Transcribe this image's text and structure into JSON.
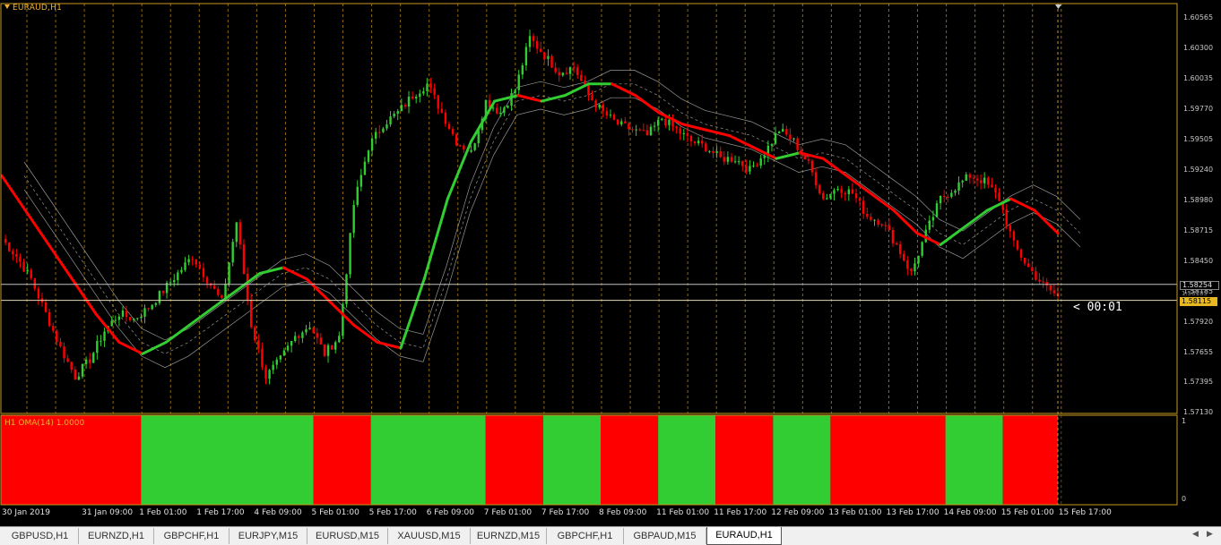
{
  "window": {
    "symbol_label": "EURAUD,H1",
    "indicator_label": "H1 OMA(14) 1.0000",
    "countdown": "< 00:01"
  },
  "colors": {
    "bull": "#32cd32",
    "bear": "#ff0000",
    "grid": "#c8961e",
    "frame": "#c8961e",
    "current_price_bg": "#e8b820"
  },
  "price_axis": {
    "ticks": [
      "1.60565",
      "1.60300",
      "1.60035",
      "1.59770",
      "1.59505",
      "1.59240",
      "1.58980",
      "1.58715",
      "1.58450",
      "1.58185",
      "1.57920",
      "1.57655",
      "1.57395",
      "1.57130"
    ],
    "hline_price": "1.58254",
    "current_price": "1.58115",
    "behind_price": "1.58185"
  },
  "indicator_axis": {
    "max": "1",
    "min": "0"
  },
  "time_axis": {
    "labels": [
      "30 Jan 2019",
      "31 Jan 09:00",
      "1 Feb 01:00",
      "1 Feb 17:00",
      "4 Feb 09:00",
      "5 Feb 01:00",
      "5 Feb 17:00",
      "6 Feb 09:00",
      "7 Feb 01:00",
      "7 Feb 17:00",
      "8 Feb 09:00",
      "11 Feb 01:00",
      "11 Feb 17:00",
      "12 Feb 09:00",
      "13 Feb 01:00",
      "13 Feb 17:00",
      "14 Feb 09:00",
      "15 Feb 01:00",
      "15 Feb 17:00"
    ]
  },
  "tabs": [
    {
      "label": "GBPUSD,H1",
      "active": false
    },
    {
      "label": "EURNZD,H1",
      "active": false
    },
    {
      "label": "GBPCHF,H1",
      "active": false
    },
    {
      "label": "EURJPY,M15",
      "active": false
    },
    {
      "label": "EURUSD,M15",
      "active": false
    },
    {
      "label": "XAUUSD,M15",
      "active": false
    },
    {
      "label": "EURNZD,M15",
      "active": false
    },
    {
      "label": "GBPCHF,H1",
      "active": false
    },
    {
      "label": "GBPAUD,M15",
      "active": false
    },
    {
      "label": "EURAUD,H1",
      "active": true
    }
  ],
  "nav": {
    "left_icon": "triangle-left-icon",
    "right_icon": "triangle-right-icon"
  },
  "chart_data": {
    "type": "candlestick",
    "symbol": "EURAUD",
    "timeframe": "H1",
    "ylim": [
      1.5713,
      1.607
    ],
    "candles_close_trace": [
      1.5865,
      1.585,
      1.583,
      1.58,
      1.577,
      1.5745,
      1.576,
      1.5785,
      1.58,
      1.5795,
      1.5805,
      1.582,
      1.5835,
      1.585,
      1.583,
      1.581,
      1.588,
      1.579,
      1.5745,
      1.576,
      1.578,
      1.579,
      1.5765,
      1.578,
      1.5895,
      1.5945,
      1.5965,
      1.5975,
      1.599,
      1.6,
      1.5975,
      1.595,
      1.594,
      1.5985,
      1.5975,
      1.5995,
      1.604,
      1.6025,
      1.601,
      1.6015,
      1.599,
      1.5975,
      1.5965,
      1.596,
      1.5955,
      1.597,
      1.596,
      1.595,
      1.5945,
      1.5935,
      1.5935,
      1.5925,
      1.594,
      1.596,
      1.595,
      1.593,
      1.59,
      1.591,
      1.5905,
      1.5885,
      1.588,
      1.586,
      1.5835,
      1.587,
      1.59,
      1.591,
      1.592,
      1.5915,
      1.59,
      1.586,
      1.584,
      1.5825,
      1.5815
    ],
    "oma_trace": [
      1.592,
      1.589,
      1.586,
      1.583,
      1.58,
      1.5775,
      1.5765,
      1.5775,
      1.579,
      1.5805,
      1.582,
      1.5835,
      1.584,
      1.583,
      1.581,
      1.579,
      1.5775,
      1.577,
      1.583,
      1.59,
      1.595,
      1.5985,
      1.599,
      1.5985,
      1.599,
      1.6,
      1.6,
      1.599,
      1.5975,
      1.5965,
      1.596,
      1.5955,
      1.5945,
      1.5935,
      1.594,
      1.5935,
      1.592,
      1.5905,
      1.589,
      1.587,
      1.586,
      1.5875,
      1.589,
      1.59,
      1.589,
      1.587
    ],
    "indicator_segments": [
      {
        "color": "red",
        "from_label": "30 Jan 2019"
      },
      {
        "color": "green",
        "from_label": "1 Feb 01:00"
      },
      {
        "color": "red",
        "from_label": "5 Feb 01:00"
      },
      {
        "color": "green",
        "from_label": "5 Feb 17:00"
      },
      {
        "color": "red",
        "from_label": "7 Feb 01:00"
      },
      {
        "color": "green",
        "from_label": "7 Feb 17:00"
      },
      {
        "color": "red",
        "from_label": "8 Feb 09:00"
      },
      {
        "color": "green",
        "from_label": "11 Feb 01:00"
      },
      {
        "color": "red",
        "from_label": "11 Feb 17:00"
      },
      {
        "color": "green",
        "from_label": "12 Feb 09:00"
      },
      {
        "color": "red",
        "from_label": "13 Feb 01:00"
      },
      {
        "color": "green",
        "from_label": "14 Feb 09:00"
      },
      {
        "color": "red",
        "from_label": "15 Feb 01:00"
      }
    ],
    "grid": true
  }
}
